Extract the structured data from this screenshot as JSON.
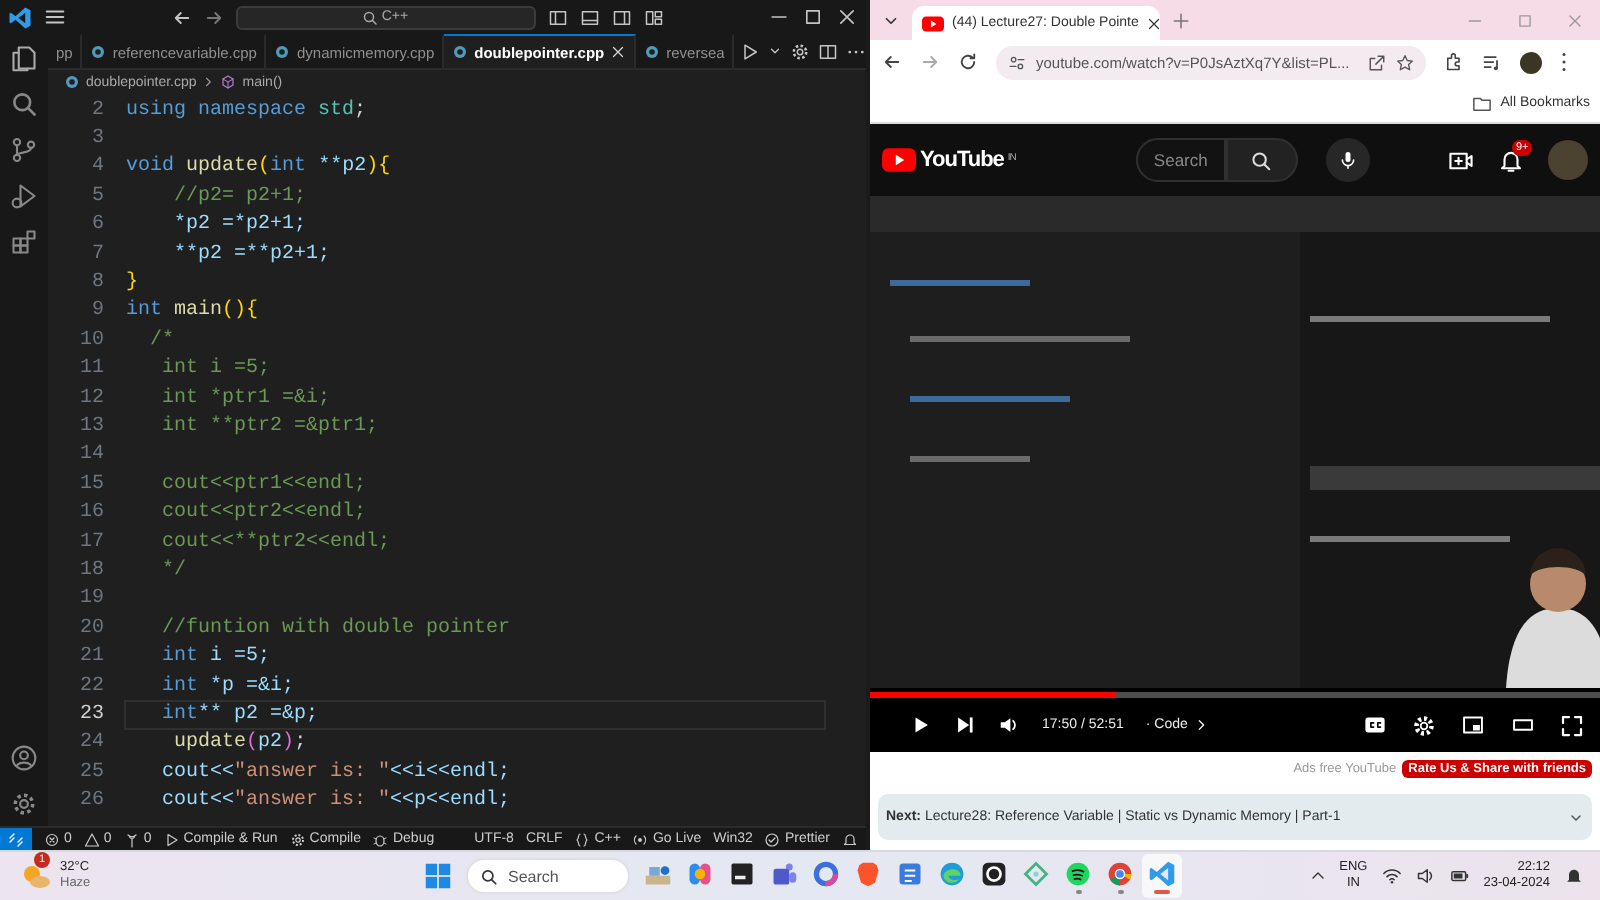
{
  "vscode": {
    "title_search": "C++",
    "tabs": [
      {
        "label": "pp",
        "selected": false
      },
      {
        "label": "referencevariable.cpp",
        "selected": false
      },
      {
        "label": "dynamicmemory.cpp",
        "selected": false
      },
      {
        "label": "doublepointer.cpp",
        "selected": true
      },
      {
        "label": "reversea",
        "selected": false
      }
    ],
    "breadcrumb": [
      "doublepointer.cpp",
      "main()"
    ],
    "lines": [
      {
        "number": "2",
        "current": false,
        "tokens": [
          {
            "text": "using ",
            "kind": "kw"
          },
          {
            "text": "namespace ",
            "kind": "kw"
          },
          {
            "text": "std",
            "kind": "type"
          },
          {
            "text": ";",
            "kind": "op"
          }
        ]
      },
      {
        "number": "3",
        "current": false
      },
      {
        "number": "4",
        "current": false,
        "tokens": [
          {
            "text": "void ",
            "kind": "kw"
          },
          {
            "text": "update",
            "kind": "fn"
          },
          {
            "text": "(",
            "kind": "brace"
          },
          {
            "text": "int ",
            "kind": "kw"
          },
          {
            "text": "**p2",
            "kind": "var"
          },
          {
            "text": ")",
            "kind": "brace"
          },
          {
            "text": "{",
            "kind": "brace"
          }
        ]
      },
      {
        "number": "5",
        "current": false,
        "tokens": [
          {
            "text": "    //p2= p2+1;",
            "kind": "comment"
          }
        ]
      },
      {
        "number": "6",
        "current": false,
        "tokens": [
          {
            "text": "    *p2 =*p2+1;",
            "kind": "var"
          }
        ]
      },
      {
        "number": "7",
        "current": false,
        "tokens": [
          {
            "text": "    **p2 =**p2+1;",
            "kind": "var"
          }
        ]
      },
      {
        "number": "8",
        "current": false,
        "tokens": [
          {
            "text": "}",
            "kind": "brace"
          }
        ]
      },
      {
        "number": "9",
        "current": false,
        "tokens": [
          {
            "text": "int ",
            "kind": "kw"
          },
          {
            "text": "main",
            "kind": "fn"
          },
          {
            "text": "()",
            "kind": "brace"
          },
          {
            "text": "{",
            "kind": "brace"
          }
        ]
      },
      {
        "number": "10",
        "current": false,
        "tokens": [
          {
            "text": "  /*",
            "kind": "comment"
          }
        ]
      },
      {
        "number": "11",
        "current": false,
        "tokens": [
          {
            "text": "   int i =5;",
            "kind": "comment"
          }
        ]
      },
      {
        "number": "12",
        "current": false,
        "tokens": [
          {
            "text": "   int *ptr1 =&i;",
            "kind": "comment"
          }
        ]
      },
      {
        "number": "13",
        "current": false,
        "tokens": [
          {
            "text": "   int **ptr2 =&ptr1;",
            "kind": "comment"
          }
        ]
      },
      {
        "number": "14",
        "current": false
      },
      {
        "number": "15",
        "current": false,
        "tokens": [
          {
            "text": "   cout<<ptr1<<endl;",
            "kind": "comment"
          }
        ]
      },
      {
        "number": "16",
        "current": false,
        "tokens": [
          {
            "text": "   cout<<ptr2<<endl;",
            "kind": "comment"
          }
        ]
      },
      {
        "number": "17",
        "current": false,
        "tokens": [
          {
            "text": "   cout<<**ptr2<<endl;",
            "kind": "comment"
          }
        ]
      },
      {
        "number": "18",
        "current": false,
        "tokens": [
          {
            "text": "   */",
            "kind": "comment"
          }
        ]
      },
      {
        "number": "19",
        "current": false
      },
      {
        "number": "20",
        "current": false,
        "tokens": [
          {
            "text": "   //funtion with double pointer",
            "kind": "comment"
          }
        ]
      },
      {
        "number": "21",
        "current": false,
        "tokens": [
          {
            "text": "   int ",
            "kind": "kw"
          },
          {
            "text": "i =5;",
            "kind": "var"
          }
        ]
      },
      {
        "number": "22",
        "current": false,
        "tokens": [
          {
            "text": "   int ",
            "kind": "kw"
          },
          {
            "text": "*p =&i;",
            "kind": "var"
          }
        ]
      },
      {
        "number": "23",
        "current": true,
        "tokens": [
          {
            "text": "   int",
            "kind": "kw"
          },
          {
            "text": "** p2 =&p;",
            "kind": "var"
          }
        ]
      },
      {
        "number": "24",
        "current": false,
        "tokens": [
          {
            "text": "    update",
            "kind": "fn"
          },
          {
            "text": "(",
            "kind": "paren"
          },
          {
            "text": "p2",
            "kind": "var"
          },
          {
            "text": ")",
            "kind": "paren"
          },
          {
            "text": ";",
            "kind": "op"
          }
        ]
      },
      {
        "number": "25",
        "current": false,
        "tokens": [
          {
            "text": "   cout<<",
            "kind": "var"
          },
          {
            "text": "\"answer is: \"",
            "kind": "string"
          },
          {
            "text": "<<i<<endl;",
            "kind": "var"
          }
        ]
      },
      {
        "number": "26",
        "current": false,
        "tokens": [
          {
            "text": "   cout<<",
            "kind": "var"
          },
          {
            "text": "\"answer is: \"",
            "kind": "string"
          },
          {
            "text": "<<p<<endl;",
            "kind": "var"
          }
        ]
      }
    ],
    "status_left": [
      {
        "kind": "remote"
      },
      {
        "kind": "errors",
        "text": "0"
      },
      {
        "kind": "warnings",
        "text": "0"
      },
      {
        "kind": "ports",
        "text": "0"
      },
      {
        "kind": "run",
        "text": "Compile & Run"
      },
      {
        "kind": "gear",
        "text": "Compile"
      },
      {
        "kind": "bug",
        "text": "Debug"
      }
    ],
    "status_right": [
      {
        "kind": "plain",
        "text": "UTF-8"
      },
      {
        "kind": "plain",
        "text": "CRLF"
      },
      {
        "kind": "braces",
        "text": "C++"
      },
      {
        "kind": "broadcast",
        "text": "Go Live"
      },
      {
        "kind": "plain",
        "text": "Win32"
      },
      {
        "kind": "check",
        "text": "Prettier"
      },
      {
        "kind": "bell"
      }
    ]
  },
  "browser": {
    "tabs": [
      {
        "title": "(44) Lecture27: Double Pointe",
        "selected": true
      }
    ],
    "address": "youtube.com/watch?v=P0JsAztXq7Y&list=PL...",
    "bookmarks_folder": "All Bookmarks"
  },
  "youtube": {
    "logo_text": "YouTube",
    "logo_region": "IN",
    "search_placeholder": "Search",
    "notification_badge": "9+",
    "player": {
      "level": 0.337,
      "time": "17:50 / 52:51",
      "chapter": "· Code"
    },
    "ads_text": "Ads free YouTube",
    "promo_button": "Rate Us & Share with friends",
    "next": "**Next:** Lecture28: Reference Variable | Static vs Dynamic Memory | Part-1"
  },
  "taskbar": {
    "weather": {
      "badge": "1",
      "temperature": "32°C",
      "condition": "Haze"
    },
    "search_placeholder": "Search",
    "apps": [
      {
        "kind": "widget",
        "running": false,
        "active": false
      },
      {
        "kind": "copilot",
        "running": false,
        "active": false
      },
      {
        "kind": "terminal",
        "running": false,
        "active": false
      },
      {
        "kind": "teams",
        "running": false,
        "active": false
      },
      {
        "kind": "m365",
        "running": false,
        "active": false
      },
      {
        "kind": "brave",
        "running": false,
        "active": false
      },
      {
        "kind": "notes",
        "running": false,
        "active": false
      },
      {
        "kind": "edge",
        "running": false,
        "active": false
      },
      {
        "kind": "github",
        "running": false,
        "active": false
      },
      {
        "kind": "diamond",
        "running": false,
        "active": false
      },
      {
        "kind": "spotify",
        "running": true,
        "active": false
      },
      {
        "kind": "chrome",
        "running": true,
        "active": false
      },
      {
        "kind": "vscode",
        "running": true,
        "active": true
      }
    ],
    "language": "ENG",
    "region": "IN",
    "time": "22:12",
    "date": "23-04-2024"
  }
}
